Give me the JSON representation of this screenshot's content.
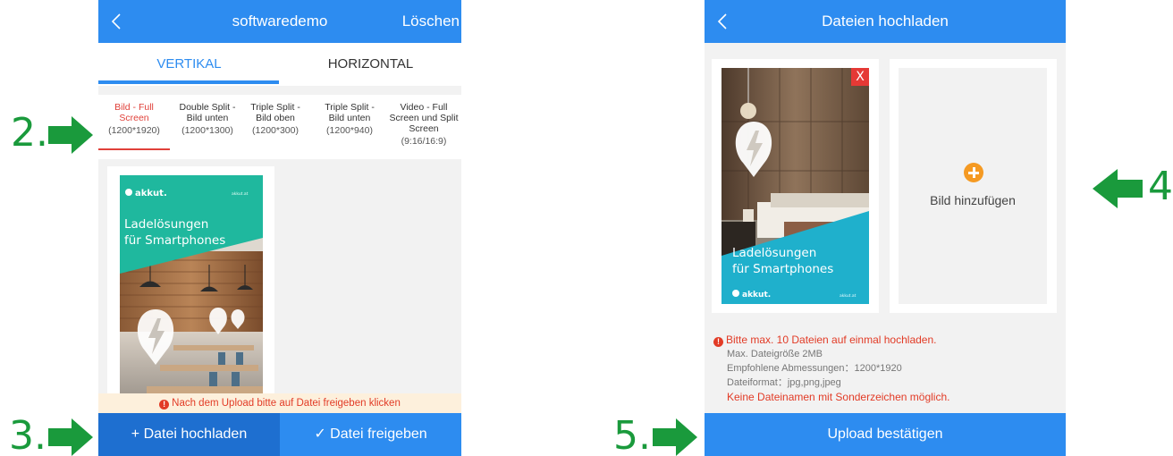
{
  "markers": {
    "step2": "2.",
    "step3": "3.",
    "step4": "4.",
    "step5": "5."
  },
  "colors": {
    "accent": "#2d8cf0",
    "accent_dark": "#1e6fd0",
    "warning": "#e23b26",
    "marker_green": "#1a9a3c",
    "add_orange": "#f59a23"
  },
  "left_screen": {
    "header": {
      "title": "softwaredemo",
      "right_action": "Löschen",
      "back_icon": "chevron-left-icon"
    },
    "tabs": [
      {
        "label": "VERTIKAL",
        "active": true
      },
      {
        "label": "HORIZONTAL",
        "active": false
      }
    ],
    "formats": [
      {
        "name": "Bild - Full Screen",
        "size": "(1200*1920)",
        "active": true
      },
      {
        "name": "Double Split - Bild unten",
        "size": "(1200*1300)",
        "active": false
      },
      {
        "name": "Triple Split - Bild oben",
        "size": "(1200*300)",
        "active": false
      },
      {
        "name": "Triple Split - Bild unten",
        "size": "(1200*940)",
        "active": false
      },
      {
        "name": "Video - Full Screen und Split Screen",
        "size": "(9:16/16:9)",
        "active": false
      }
    ],
    "poster": {
      "brand": "akkut.",
      "url": "akkut.at",
      "headline_line1": "Ladelösungen",
      "headline_line2": "für Smartphones"
    },
    "notice": "Nach dem Upload bitte auf Datei freigeben klicken",
    "buttons": {
      "upload": "+ Datei hochladen",
      "share": "✓ Datei freigeben"
    }
  },
  "right_screen": {
    "header": {
      "title": "Dateien hochladen",
      "back_icon": "chevron-left-icon"
    },
    "uploaded_image": {
      "remove_label": "X",
      "headline_line1": "Ladelösungen",
      "headline_line2": "für Smartphones",
      "brand": "akkut.",
      "url": "akkut.at"
    },
    "add_image_label": "Bild hinzufügen",
    "rules": {
      "warning": "Bitte max. 10 Dateien auf einmal hochladen.",
      "max_size": "Max. Dateigröße 2MB",
      "dimensions": "Empfohlene Abmessungen：1200*1920",
      "format": "Dateiformat：jpg,png,jpeg",
      "no_special_chars": "Keine Dateinamen mit Sonderzeichen möglich."
    },
    "confirm_button": "Upload bestätigen"
  }
}
